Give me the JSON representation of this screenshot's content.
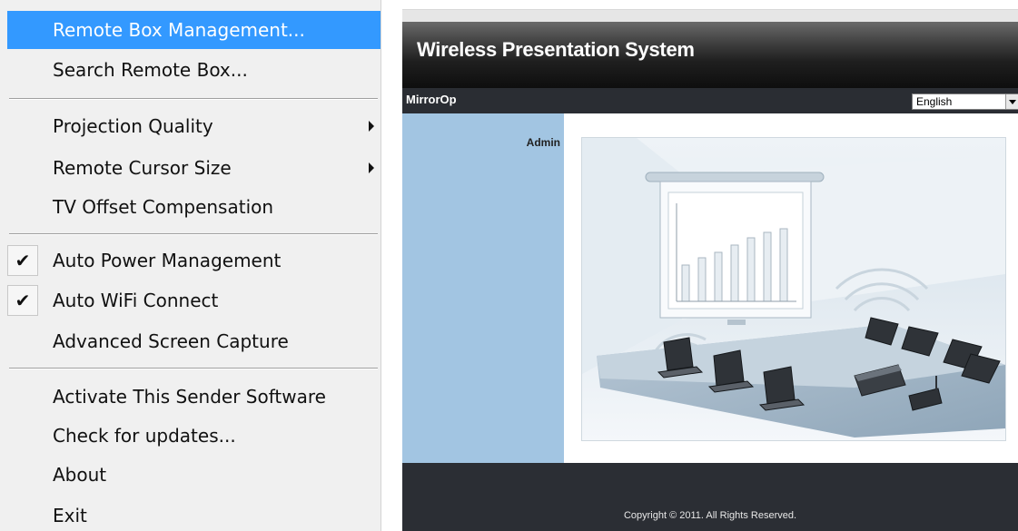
{
  "menu": {
    "items": [
      {
        "label": "Remote Box Management...",
        "highlighted": true
      },
      {
        "label": "Search Remote Box..."
      },
      {
        "label": "Projection Quality",
        "submenu": true
      },
      {
        "label": "Remote Cursor Size",
        "submenu": true
      },
      {
        "label": "TV Offset Compensation"
      },
      {
        "label": "Auto Power Management",
        "checked": true
      },
      {
        "label": "Auto WiFi Connect",
        "checked": true
      },
      {
        "label": "Advanced Screen Capture"
      },
      {
        "label": "Activate This Sender Software"
      },
      {
        "label": "Check for updates..."
      },
      {
        "label": "About"
      },
      {
        "label": "Exit"
      }
    ],
    "check_glyph": "✔",
    "highlight_color": "#3399ff"
  },
  "web": {
    "banner_title": "Wireless Presentation System",
    "nav_brand": "MirrorOp",
    "language": {
      "selected": "English"
    },
    "sidebar": {
      "admin_label": "Admin"
    },
    "footer": {
      "copyright": "Copyright © 2011. All Rights Reserved."
    },
    "colors": {
      "sidebar": "#a2c5e2",
      "nav": "#2a2d33",
      "footer": "#2b2e34"
    }
  }
}
